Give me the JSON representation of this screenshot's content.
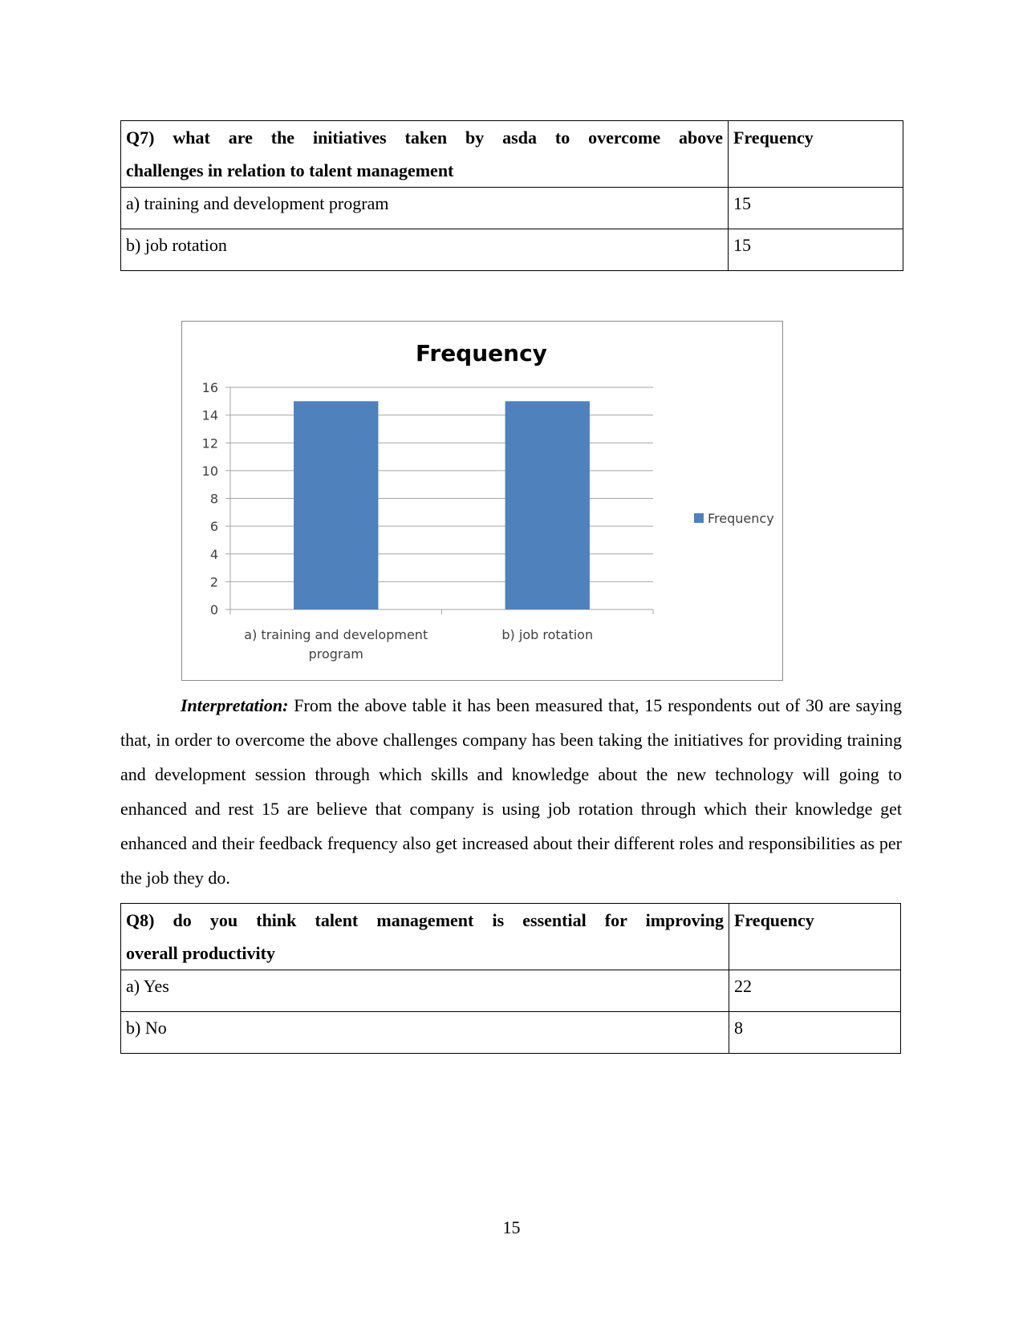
{
  "q7_table": {
    "question": "Q7) what are the initiatives taken by asda to overcome above challenges in relation  to talent management",
    "question_line1": "Q7) what are the initiatives taken by asda to overcome above",
    "question_line2": "challenges in relation  to talent management",
    "header_frequency": "Frequency",
    "rows": [
      {
        "option": "a) training and development program",
        "frequency": "15"
      },
      {
        "option": "b) job rotation",
        "frequency": "15"
      }
    ]
  },
  "chart_data": {
    "type": "bar",
    "title": "Frequency",
    "categories": [
      "a) training and development program",
      "b) job rotation"
    ],
    "category_label_lines": [
      [
        "a) training and development",
        "program"
      ],
      [
        "b) job rotation"
      ]
    ],
    "series": [
      {
        "name": "Frequency",
        "values": [
          15,
          15
        ],
        "color": "#4f81bd"
      }
    ],
    "xlabel": "",
    "ylabel": "",
    "ylim": [
      0,
      16
    ],
    "yticks": [
      0,
      2,
      4,
      6,
      8,
      10,
      12,
      14,
      16
    ],
    "grid": true,
    "legend": {
      "position": "right",
      "entries": [
        "Frequency"
      ]
    }
  },
  "interpretation": {
    "label": "Interpretation:",
    "text": " From the above table it has been measured that, 15 respondents out of 30 are saying that, in order to overcome the above challenges company has been taking the initiatives for providing training and development session through which skills and knowledge about the new technology will going to enhanced and rest 15 are believe that company is using job rotation through which their knowledge get enhanced and their feedback frequency also get increased about their different roles and responsibilities as per the job they do."
  },
  "q8_table": {
    "question_line1": "Q8) do you think talent management is essential for improving",
    "question_line2": "overall productivity",
    "header_frequency": "Frequency",
    "rows": [
      {
        "option": "a) Yes",
        "frequency": "22"
      },
      {
        "option": "b) No",
        "frequency": "8"
      }
    ]
  },
  "page_number": "15"
}
